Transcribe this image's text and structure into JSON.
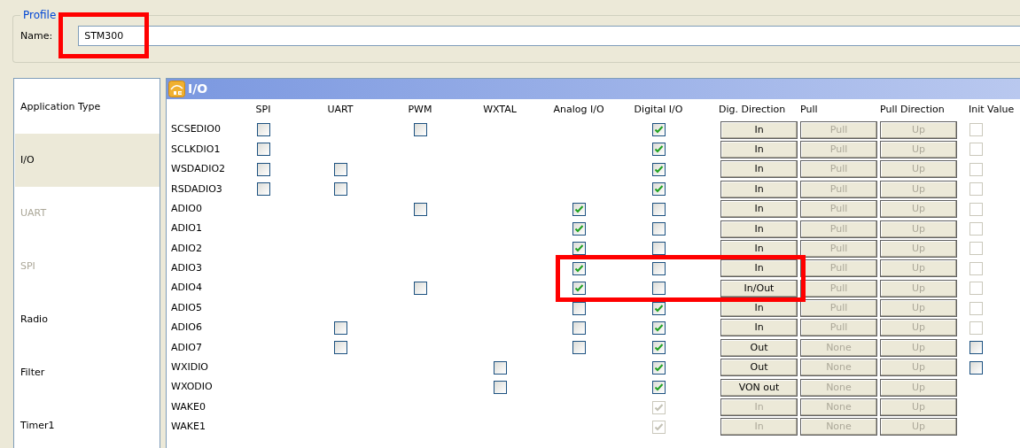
{
  "profile": {
    "legend": "Profile",
    "name_label": "Name:",
    "name_value": "STM300",
    "highlighted": true
  },
  "sidebar": {
    "items": [
      {
        "label": "Application Type",
        "selected": false,
        "disabled": false
      },
      {
        "label": "I/O",
        "selected": true,
        "disabled": false
      },
      {
        "label": "UART",
        "selected": false,
        "disabled": true
      },
      {
        "label": "SPI",
        "selected": false,
        "disabled": true
      },
      {
        "label": "Radio",
        "selected": false,
        "disabled": false
      },
      {
        "label": "Filter",
        "selected": false,
        "disabled": false
      },
      {
        "label": "Timer1",
        "selected": false,
        "disabled": false
      }
    ]
  },
  "panel": {
    "title": "I/O"
  },
  "columns": [
    {
      "label": "SPI",
      "kind": "check"
    },
    {
      "label": "UART",
      "kind": "check"
    },
    {
      "label": "PWM",
      "kind": "check"
    },
    {
      "label": "WXTAL",
      "kind": "check"
    },
    {
      "label": "Analog I/O",
      "kind": "check"
    },
    {
      "label": "Digital I/O",
      "kind": "check"
    },
    {
      "label": "Dig. Direction",
      "kind": "button"
    },
    {
      "label": "Pull",
      "kind": "button"
    },
    {
      "label": "Pull Direction",
      "kind": "button"
    },
    {
      "label": "Init Value",
      "kind": "check"
    }
  ],
  "rows": [
    {
      "name": "SCSEDIO0",
      "spi": {
        "checked": false,
        "disabled": false
      },
      "pwm": {
        "checked": false,
        "disabled": false
      },
      "digital": {
        "checked": true,
        "disabled": false
      },
      "direction": {
        "label": "In",
        "disabled": false
      },
      "pull": {
        "label": "Pull",
        "disabled": true
      },
      "pull_direction": {
        "label": "Up",
        "disabled": true
      },
      "init": {
        "checked": false,
        "disabled": true
      }
    },
    {
      "name": "SCLKDIO1",
      "spi": {
        "checked": false,
        "disabled": false
      },
      "digital": {
        "checked": true,
        "disabled": false
      },
      "direction": {
        "label": "In",
        "disabled": false
      },
      "pull": {
        "label": "Pull",
        "disabled": true
      },
      "pull_direction": {
        "label": "Up",
        "disabled": true
      },
      "init": {
        "checked": false,
        "disabled": true
      }
    },
    {
      "name": "WSDADIO2",
      "spi": {
        "checked": false,
        "disabled": false
      },
      "uart": {
        "checked": false,
        "disabled": false
      },
      "digital": {
        "checked": true,
        "disabled": false
      },
      "direction": {
        "label": "In",
        "disabled": false
      },
      "pull": {
        "label": "Pull",
        "disabled": true
      },
      "pull_direction": {
        "label": "Up",
        "disabled": true
      },
      "init": {
        "checked": false,
        "disabled": true
      }
    },
    {
      "name": "RSDADIO3",
      "spi": {
        "checked": false,
        "disabled": false
      },
      "uart": {
        "checked": false,
        "disabled": false
      },
      "digital": {
        "checked": true,
        "disabled": false
      },
      "direction": {
        "label": "In",
        "disabled": false
      },
      "pull": {
        "label": "Pull",
        "disabled": true
      },
      "pull_direction": {
        "label": "Up",
        "disabled": true
      },
      "init": {
        "checked": false,
        "disabled": true
      }
    },
    {
      "name": "ADIO0",
      "pwm": {
        "checked": false,
        "disabled": false
      },
      "analog": {
        "checked": true,
        "disabled": false
      },
      "digital": {
        "checked": false,
        "disabled": false
      },
      "direction": {
        "label": "In",
        "disabled": false
      },
      "pull": {
        "label": "Pull",
        "disabled": true
      },
      "pull_direction": {
        "label": "Up",
        "disabled": true
      },
      "init": {
        "checked": false,
        "disabled": true
      }
    },
    {
      "name": "ADIO1",
      "analog": {
        "checked": true,
        "disabled": false
      },
      "digital": {
        "checked": false,
        "disabled": false
      },
      "direction": {
        "label": "In",
        "disabled": false
      },
      "pull": {
        "label": "Pull",
        "disabled": true
      },
      "pull_direction": {
        "label": "Up",
        "disabled": true
      },
      "init": {
        "checked": false,
        "disabled": true
      }
    },
    {
      "name": "ADIO2",
      "analog": {
        "checked": true,
        "disabled": false
      },
      "digital": {
        "checked": false,
        "disabled": false
      },
      "direction": {
        "label": "In",
        "disabled": false
      },
      "pull": {
        "label": "Pull",
        "disabled": true
      },
      "pull_direction": {
        "label": "Up",
        "disabled": true
      },
      "init": {
        "checked": false,
        "disabled": true
      }
    },
    {
      "name": "ADIO3",
      "highlighted": true,
      "analog": {
        "checked": true,
        "disabled": false
      },
      "digital": {
        "checked": false,
        "disabled": false
      },
      "direction": {
        "label": "In",
        "disabled": false
      },
      "pull": {
        "label": "Pull",
        "disabled": true
      },
      "pull_direction": {
        "label": "Up",
        "disabled": true
      },
      "init": {
        "checked": false,
        "disabled": true
      }
    },
    {
      "name": "ADIO4",
      "highlighted": true,
      "pwm": {
        "checked": false,
        "disabled": false
      },
      "analog": {
        "checked": true,
        "disabled": false
      },
      "digital": {
        "checked": false,
        "disabled": false
      },
      "direction": {
        "label": "In/Out",
        "disabled": false
      },
      "pull": {
        "label": "Pull",
        "disabled": true
      },
      "pull_direction": {
        "label": "Up",
        "disabled": true
      },
      "init": {
        "checked": false,
        "disabled": true
      }
    },
    {
      "name": "ADIO5",
      "analog": {
        "checked": false,
        "disabled": false
      },
      "digital": {
        "checked": true,
        "disabled": false
      },
      "direction": {
        "label": "In",
        "disabled": false
      },
      "pull": {
        "label": "Pull",
        "disabled": true
      },
      "pull_direction": {
        "label": "Up",
        "disabled": true
      },
      "init": {
        "checked": false,
        "disabled": true
      }
    },
    {
      "name": "ADIO6",
      "uart": {
        "checked": false,
        "disabled": false
      },
      "analog": {
        "checked": false,
        "disabled": false
      },
      "digital": {
        "checked": true,
        "disabled": false
      },
      "direction": {
        "label": "In",
        "disabled": false
      },
      "pull": {
        "label": "Pull",
        "disabled": true
      },
      "pull_direction": {
        "label": "Up",
        "disabled": true
      },
      "init": {
        "checked": false,
        "disabled": true
      }
    },
    {
      "name": "ADIO7",
      "uart": {
        "checked": false,
        "disabled": false
      },
      "analog": {
        "checked": false,
        "disabled": false
      },
      "digital": {
        "checked": true,
        "disabled": false
      },
      "direction": {
        "label": "Out",
        "disabled": false
      },
      "pull": {
        "label": "None",
        "disabled": true
      },
      "pull_direction": {
        "label": "Up",
        "disabled": true
      },
      "init": {
        "checked": false,
        "disabled": false
      }
    },
    {
      "name": "WXIDIO",
      "wxtal": {
        "checked": false,
        "disabled": false
      },
      "digital": {
        "checked": true,
        "disabled": false
      },
      "direction": {
        "label": "Out",
        "disabled": false
      },
      "pull": {
        "label": "None",
        "disabled": true
      },
      "pull_direction": {
        "label": "Up",
        "disabled": true
      },
      "init": {
        "checked": false,
        "disabled": false
      }
    },
    {
      "name": "WXODIO",
      "wxtal": {
        "checked": false,
        "disabled": false
      },
      "digital": {
        "checked": true,
        "disabled": false
      },
      "direction": {
        "label": "VON out",
        "disabled": false
      },
      "pull": {
        "label": "None",
        "disabled": true
      },
      "pull_direction": {
        "label": "Up",
        "disabled": true
      }
    },
    {
      "name": "WAKE0",
      "digital": {
        "checked": true,
        "disabled": true
      },
      "direction": {
        "label": "In",
        "disabled": true
      },
      "pull": {
        "label": "None",
        "disabled": true
      },
      "pull_direction": {
        "label": "Up",
        "disabled": true
      }
    },
    {
      "name": "WAKE1",
      "digital": {
        "checked": true,
        "disabled": true
      },
      "direction": {
        "label": "In",
        "disabled": true
      },
      "pull": {
        "label": "None",
        "disabled": true
      },
      "pull_direction": {
        "label": "Up",
        "disabled": true
      }
    }
  ],
  "highlight_rows_frame": true
}
